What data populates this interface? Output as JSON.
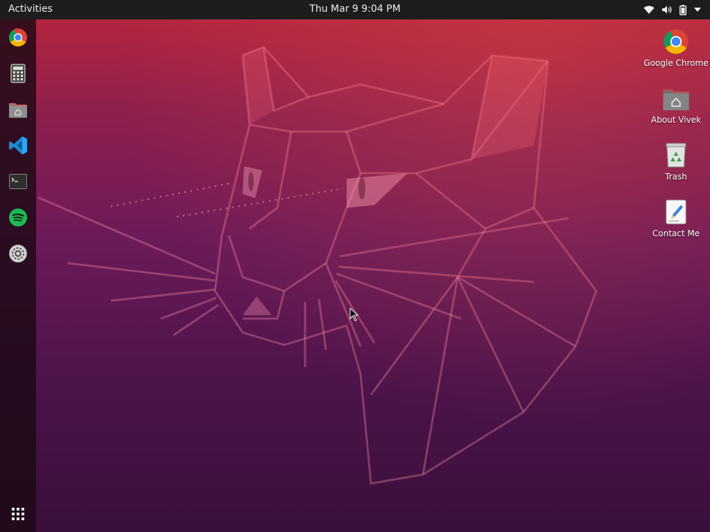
{
  "topbar": {
    "activities_label": "Activities",
    "clock": "Thu Mar 9  9:04 PM",
    "tray": [
      "wifi-icon",
      "volume-icon",
      "battery-icon",
      "system-menu-arrow-icon"
    ]
  },
  "dock": {
    "items": [
      {
        "name": "Google Chrome",
        "icon": "chrome-icon"
      },
      {
        "name": "Calculator",
        "icon": "calculator-icon"
      },
      {
        "name": "Files",
        "icon": "home-folder-icon"
      },
      {
        "name": "Visual Studio Code",
        "icon": "vscode-icon"
      },
      {
        "name": "Terminal",
        "icon": "terminal-icon"
      },
      {
        "name": "Spotify",
        "icon": "spotify-icon"
      },
      {
        "name": "Settings",
        "icon": "settings-icon"
      }
    ],
    "show_apps_icon": "app-grid-icon"
  },
  "desktop": {
    "icons": [
      {
        "label": "Google Chrome",
        "icon": "chrome-icon"
      },
      {
        "label": "About Vivek",
        "icon": "home-folder-icon"
      },
      {
        "label": "Trash",
        "icon": "trash-icon"
      },
      {
        "label": "Contact Me",
        "icon": "text-editor-icon"
      }
    ]
  },
  "colors": {
    "wallpaper_top": "#b9263c",
    "wallpaper_bottom": "#3a0f3a",
    "topbar": "#1d1d1d",
    "dock": "#1c0a16"
  }
}
